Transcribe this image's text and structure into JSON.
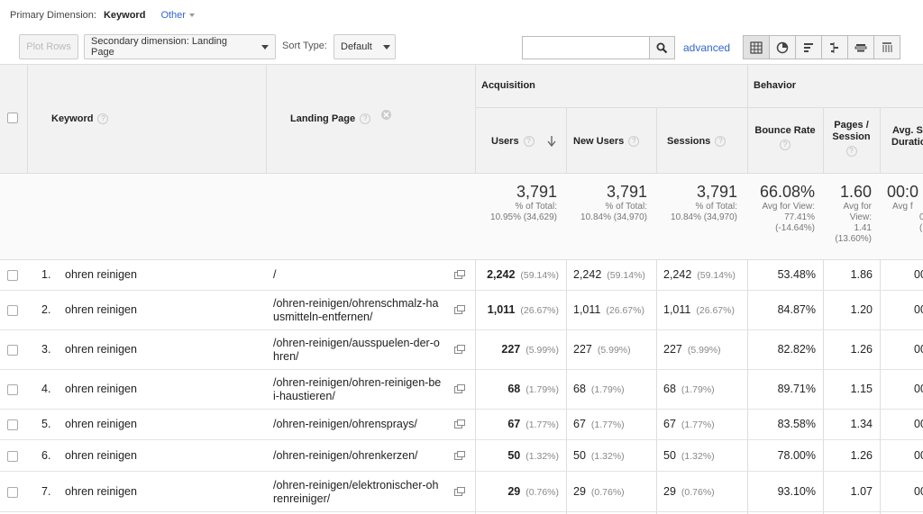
{
  "primary": {
    "label": "Primary Dimension:",
    "selected": "Keyword",
    "other": "Other"
  },
  "toolbar": {
    "plot_rows": "Plot Rows",
    "secondary_dimension": "Secondary dimension: Landing Page",
    "sort_type_label": "Sort Type:",
    "sort_type_value": "Default",
    "search_value": "",
    "advanced": "advanced"
  },
  "headers": {
    "keyword": "Keyword",
    "landing_page": "Landing Page",
    "acquisition": "Acquisition",
    "behavior": "Behavior",
    "users": "Users",
    "new_users": "New Users",
    "sessions": "Sessions",
    "bounce_rate": "Bounce Rate",
    "pages_session_1": "Pages /",
    "pages_session_2": "Session",
    "avg_duration_1": "Avg. Se",
    "avg_duration_2": "Duratio"
  },
  "totals": {
    "users": {
      "value": "3,791",
      "l1": "% of Total:",
      "l2": "10.95% (34,629)"
    },
    "new_users": {
      "value": "3,791",
      "l1": "% of Total:",
      "l2": "10.84% (34,970)"
    },
    "sessions": {
      "value": "3,791",
      "l1": "% of Total:",
      "l2": "10.84% (34,970)"
    },
    "bounce_rate": {
      "value": "66.08%",
      "l1": "Avg for View:",
      "l2": "77.41%",
      "l3": "(-14.64%)"
    },
    "pages_session": {
      "value": "1.60",
      "l1": "Avg for",
      "l2": "View:",
      "l3": "1.41",
      "l4": "(13.60%)"
    },
    "avg_duration": {
      "value": "00:0",
      "l1": "Avg f",
      "l2": "0",
      "l3": "("
    }
  },
  "rows": [
    {
      "n": "1.",
      "keyword": "ohren reinigen",
      "lp1": "/",
      "lp2": "",
      "users": "2,242",
      "users_pct": "(59.14%)",
      "new_users": "2,242",
      "new_users_pct": "(59.14%)",
      "sessions": "2,242",
      "sessions_pct": "(59.14%)",
      "bounce": "53.48%",
      "pages": "1.86",
      "dur": "00"
    },
    {
      "n": "2.",
      "keyword": "ohren reinigen",
      "lp1": "/ohren-reinigen/ohrenschmalz-ha",
      "lp2": "usmitteln-entfernen/",
      "users": "1,011",
      "users_pct": "(26.67%)",
      "new_users": "1,011",
      "new_users_pct": "(26.67%)",
      "sessions": "1,011",
      "sessions_pct": "(26.67%)",
      "bounce": "84.87%",
      "pages": "1.20",
      "dur": "00"
    },
    {
      "n": "3.",
      "keyword": "ohren reinigen",
      "lp1": "/ohren-reinigen/ausspuelen-der-o",
      "lp2": "hren/",
      "users": "227",
      "users_pct": "(5.99%)",
      "new_users": "227",
      "new_users_pct": "(5.99%)",
      "sessions": "227",
      "sessions_pct": "(5.99%)",
      "bounce": "82.82%",
      "pages": "1.26",
      "dur": "00"
    },
    {
      "n": "4.",
      "keyword": "ohren reinigen",
      "lp1": "/ohren-reinigen/ohren-reinigen-be",
      "lp2": "i-haustieren/",
      "users": "68",
      "users_pct": "(1.79%)",
      "new_users": "68",
      "new_users_pct": "(1.79%)",
      "sessions": "68",
      "sessions_pct": "(1.79%)",
      "bounce": "89.71%",
      "pages": "1.15",
      "dur": "00"
    },
    {
      "n": "5.",
      "keyword": "ohren reinigen",
      "lp1": "/ohren-reinigen/ohrensprays/",
      "lp2": "",
      "users": "67",
      "users_pct": "(1.77%)",
      "new_users": "67",
      "new_users_pct": "(1.77%)",
      "sessions": "67",
      "sessions_pct": "(1.77%)",
      "bounce": "83.58%",
      "pages": "1.34",
      "dur": "00"
    },
    {
      "n": "6.",
      "keyword": "ohren reinigen",
      "lp1": "/ohren-reinigen/ohrenkerzen/",
      "lp2": "",
      "users": "50",
      "users_pct": "(1.32%)",
      "new_users": "50",
      "new_users_pct": "(1.32%)",
      "sessions": "50",
      "sessions_pct": "(1.32%)",
      "bounce": "78.00%",
      "pages": "1.26",
      "dur": "00"
    },
    {
      "n": "7.",
      "keyword": "ohren reinigen",
      "lp1": "/ohren-reinigen/elektronischer-oh",
      "lp2": "renreiniger/",
      "users": "29",
      "users_pct": "(0.76%)",
      "new_users": "29",
      "new_users_pct": "(0.76%)",
      "sessions": "29",
      "sessions_pct": "(0.76%)",
      "bounce": "93.10%",
      "pages": "1.07",
      "dur": "00"
    }
  ]
}
